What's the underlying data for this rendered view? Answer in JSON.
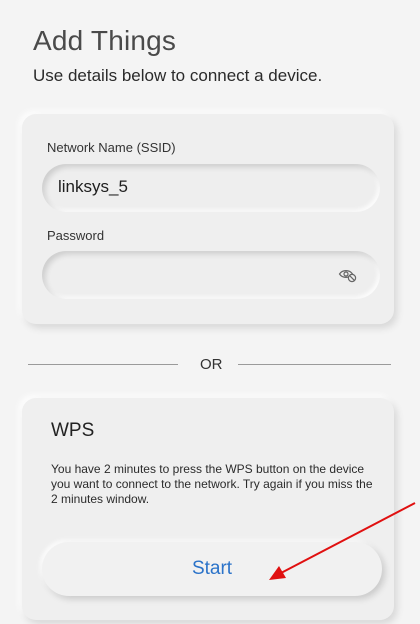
{
  "header": {
    "title": "Add Things",
    "subtitle": "Use details below to connect a device."
  },
  "network_form": {
    "ssid_label": "Network Name (SSID)",
    "ssid_value": "linksys_5",
    "password_label": "Password",
    "password_value": "",
    "password_toggle_icon": "eye-slash-icon"
  },
  "divider": {
    "label": "OR"
  },
  "wps": {
    "title": "WPS",
    "description": "You have 2 minutes to press the WPS button on the device you want to connect to the network. Try again if you miss the 2 minutes window.",
    "start_label": "Start"
  },
  "colors": {
    "accent": "#2b73c9",
    "annotation": "#e01010",
    "background": "#f4f4f4"
  }
}
